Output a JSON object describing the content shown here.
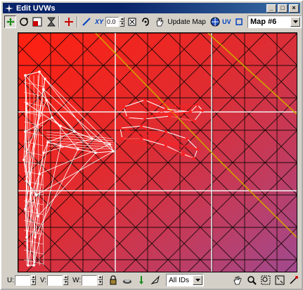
{
  "window": {
    "title": "Edit UVWs",
    "minimize": "_",
    "maximize": "□",
    "close": "×"
  },
  "toolbar": {
    "tools": [
      "move-icon",
      "rotate-icon",
      "scale-icon",
      "freeform-icon",
      "mirror-icon",
      "pan-uv-icon",
      "xy-toggle-icon"
    ],
    "xy_label": "XY",
    "value": "0.0",
    "update_map_label": "Update Map",
    "uv_label": "UV",
    "map_select": "Map #6"
  },
  "status": {
    "u_label": "U:",
    "v_label": "V:",
    "w_label": "W:",
    "id_filter": "All IDs"
  },
  "colors": {
    "titlebar": "#0a246a",
    "viewport_red": "#ff2010",
    "viewport_purple": "#b04a8a",
    "uv_edge": "#d0a000",
    "mesh": "#ffffff",
    "selected": "#ff2020"
  }
}
